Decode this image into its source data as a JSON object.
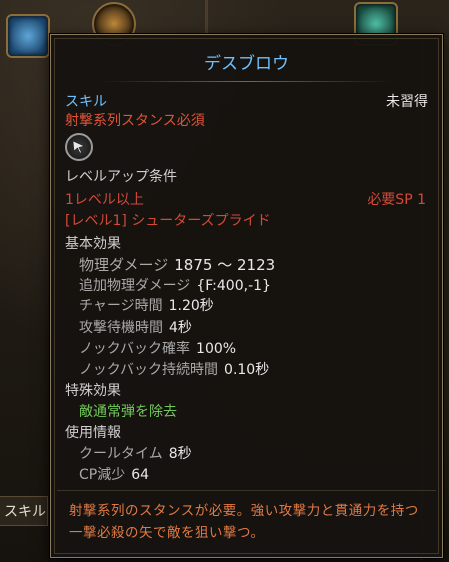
{
  "background": {
    "tab_label": "スキルツ"
  },
  "tooltip": {
    "title": "デスブロウ",
    "skill_type": "スキル",
    "status": "未習得",
    "required_stance": "射撃系列スタンス必須",
    "icon": "cursor-arrow-icon",
    "levelup_header": "レベルアップ条件",
    "req_level": "1レベル以上",
    "req_sp": "必要SP 1",
    "req_prev_skill": "[レベル1] シューターズプライド",
    "basic_effect_header": "基本効果",
    "stats": [
      {
        "label": "物理ダメージ",
        "value": "1875 ～ 2123"
      },
      {
        "label": "追加物理ダメージ",
        "value": "{F:400,-1}"
      },
      {
        "label": "チャージ時間",
        "value": "1.20秒"
      },
      {
        "label": "攻撃待機時間",
        "value": "4秒"
      },
      {
        "label": "ノックバック確率",
        "value": "100%"
      },
      {
        "label": "ノックバック持続時間",
        "value": "0.10秒"
      }
    ],
    "special_effect_header": "特殊効果",
    "special_effect": "敵通常弾を除去",
    "usage_header": "使用情報",
    "usage": [
      {
        "label": "クールタイム",
        "value": "8秒"
      },
      {
        "label": "CP減少",
        "value": "64"
      }
    ],
    "description": "射撃系列のスタンスが必要。強い攻撃力と貫通力を持つ一撃必殺の矢で敵を狙い撃つ。"
  },
  "colors": {
    "title": "#6ec0ff",
    "requirement": "#d2493a",
    "special": "#72c85a",
    "description": "#e07a45"
  }
}
